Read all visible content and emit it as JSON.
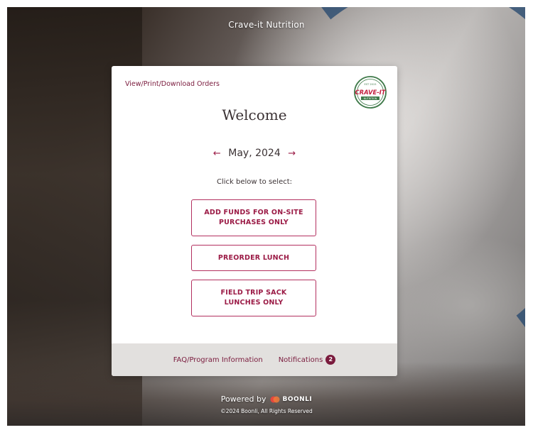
{
  "header": {
    "title": "Crave-it Nutrition"
  },
  "card": {
    "view_orders_link": "View/Print/Download Orders",
    "logo": {
      "top_text": "EST 2015",
      "main_text": "CRAVE-IT",
      "sub_text": "NUTRITION"
    },
    "welcome": "Welcome",
    "month_nav": {
      "prev_arrow": "←",
      "month": "May, 2024",
      "next_arrow": "→"
    },
    "instruction": "Click below to select:",
    "options": [
      {
        "label": "ADD FUNDS FOR ON-SITE PURCHASES ONLY"
      },
      {
        "label": "PREORDER LUNCH"
      },
      {
        "label": "FIELD TRIP SACK LUNCHES ONLY"
      }
    ]
  },
  "footer": {
    "faq_link": "FAQ/Program Information",
    "notifications_label": "Notifications",
    "notifications_count": "2"
  },
  "branding": {
    "powered_by": "Powered by",
    "boonli_name": "BOONLI",
    "copyright": "©2024 Boonli, All Rights Reserved"
  },
  "colors": {
    "accent": "#9b1b46",
    "dark_accent": "#7a1b3d",
    "footer_bg": "#e2e0de"
  }
}
